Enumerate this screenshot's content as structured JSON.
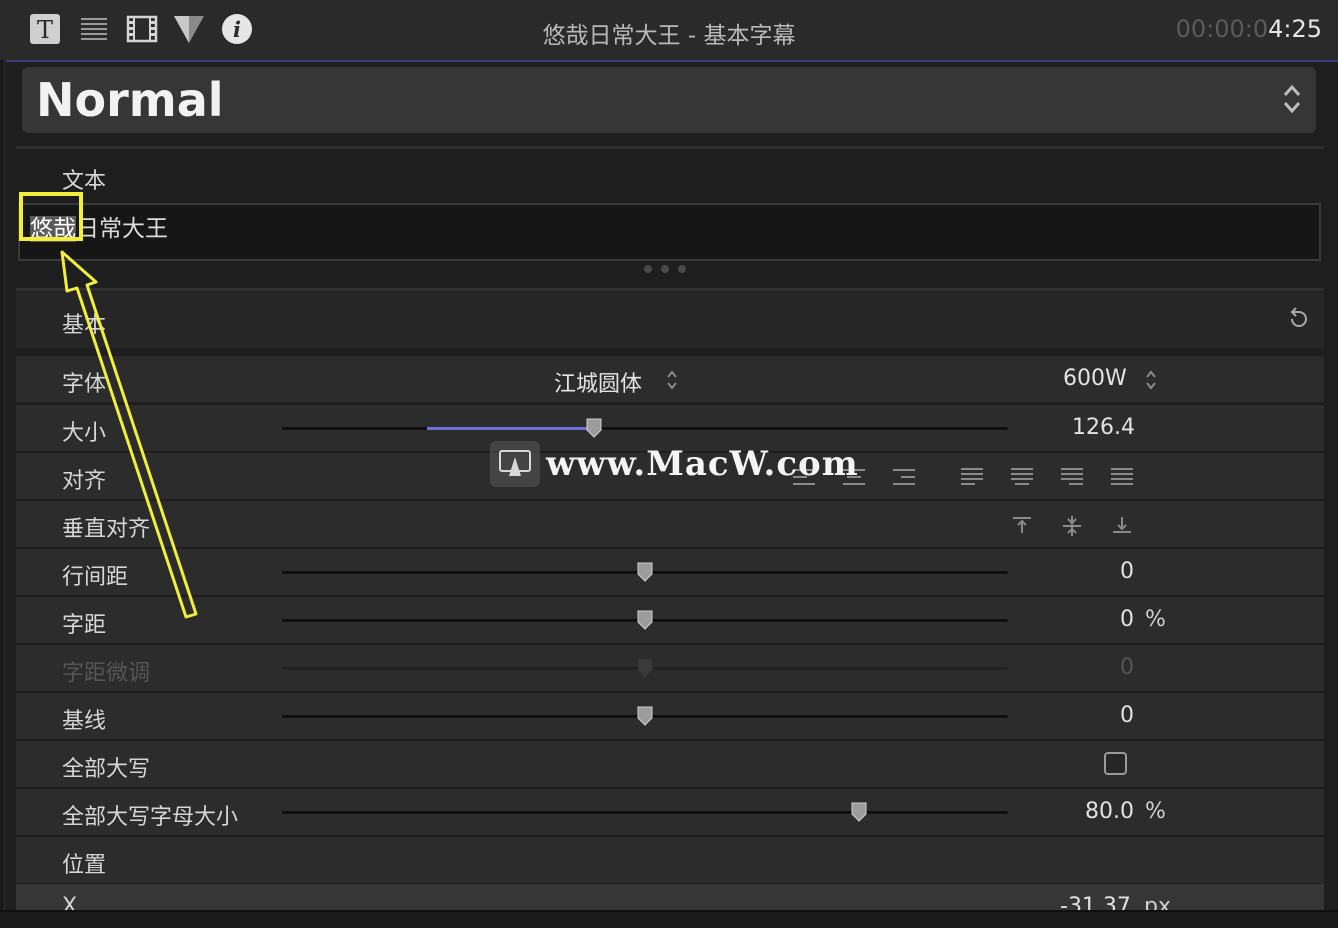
{
  "toolbar": {
    "icons": [
      "text-icon",
      "lines-icon",
      "film-icon",
      "shape-icon",
      "info-icon"
    ],
    "title": "悠哉日常大王 - 基本字幕",
    "timecode_dim": "00:00:0",
    "timecode_lit": "4:25"
  },
  "preset": {
    "name": "Normal"
  },
  "text_section": {
    "label": "文本",
    "selected_text": "悠哉",
    "remaining_text": "日常大王"
  },
  "basic": {
    "label": "基本"
  },
  "rows": {
    "font": {
      "label": "字体",
      "family": "江城圆体",
      "weight": "600W"
    },
    "size": {
      "label": "大小",
      "value": "126.4",
      "position": 0.43
    },
    "alignment": {
      "label": "对齐"
    },
    "vertical_alignment": {
      "label": "垂直对齐"
    },
    "line_spacing": {
      "label": "行间距",
      "value": "0",
      "position": 0.5
    },
    "tracking": {
      "label": "字距",
      "value": "0",
      "unit": "%",
      "position": 0.5
    },
    "kerning": {
      "label": "字距微调",
      "value": "0",
      "position": 0.5
    },
    "baseline": {
      "label": "基线",
      "value": "0",
      "position": 0.5
    },
    "all_caps": {
      "label": "全部大写",
      "checked": false
    },
    "all_caps_size": {
      "label": "全部大写字母大小",
      "value": "80.0",
      "unit": "%",
      "position": 0.795
    },
    "position": {
      "label": "位置"
    },
    "x": {
      "label": "X",
      "value": "-31.37",
      "unit": "px"
    }
  },
  "watermark": {
    "text": "www.MacW.com"
  },
  "colors": {
    "accent": "#6f6fd8",
    "annotation": "#f3ee3b",
    "background": "#1e1e1e"
  }
}
